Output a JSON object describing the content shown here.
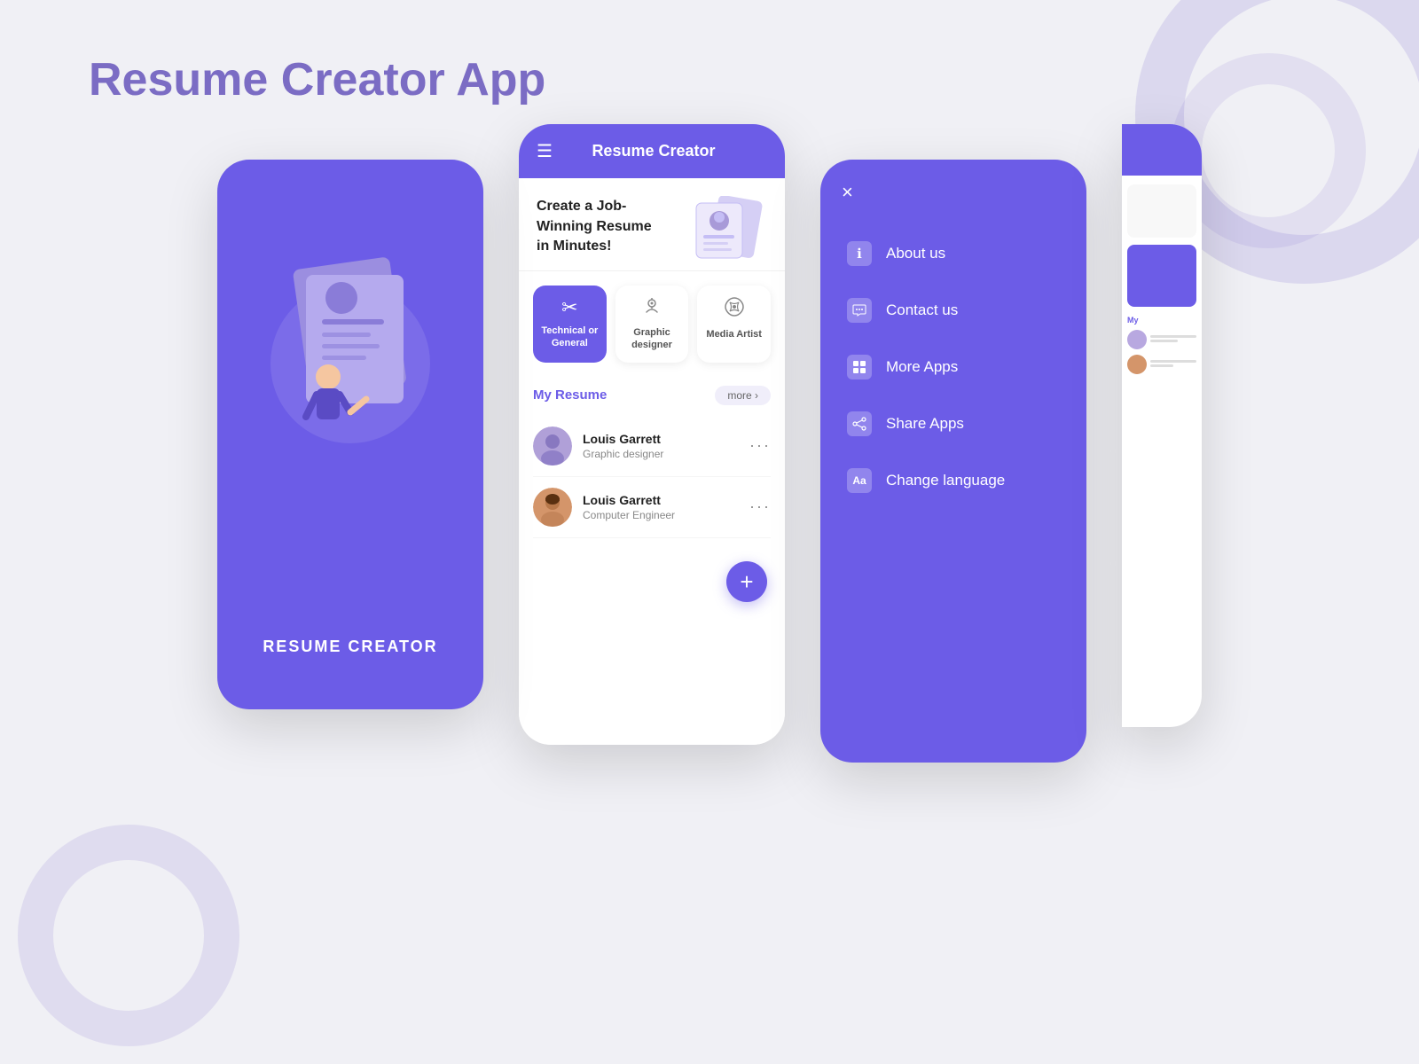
{
  "page": {
    "title": "Resume Creator App",
    "background_color": "#f0f0f5"
  },
  "phone1": {
    "title": "RESUME CREATOR",
    "background": "#6c5ce7"
  },
  "phone2": {
    "header": {
      "title": "Resume Creator",
      "menu_icon": "☰"
    },
    "hero": {
      "text": "Create a Job-Winning Resume in Minutes!"
    },
    "categories": [
      {
        "label": "Technical or General",
        "icon": "✂",
        "active": true
      },
      {
        "label": "Graphic designer",
        "icon": "✦",
        "active": false
      },
      {
        "label": "Media Artist",
        "icon": "🎭",
        "active": false
      }
    ],
    "my_resume": {
      "title": "My Resume",
      "more_label": "more ›"
    },
    "resumes": [
      {
        "name": "Louis Garrett",
        "role": "Graphic designer",
        "avatar_color": "#8a7ac8"
      },
      {
        "name": "Louis Garrett",
        "role": "Computer Engineer",
        "avatar_color": "#c4855a"
      }
    ],
    "fab_label": "+"
  },
  "phone3": {
    "close_icon": "×",
    "menu_items": [
      {
        "label": "About us",
        "icon": "ℹ"
      },
      {
        "label": "Contact us",
        "icon": "📞"
      },
      {
        "label": "More Apps",
        "icon": "⊞"
      },
      {
        "label": "Share Apps",
        "icon": "↗"
      },
      {
        "label": "Change language",
        "icon": "Aа"
      }
    ]
  }
}
